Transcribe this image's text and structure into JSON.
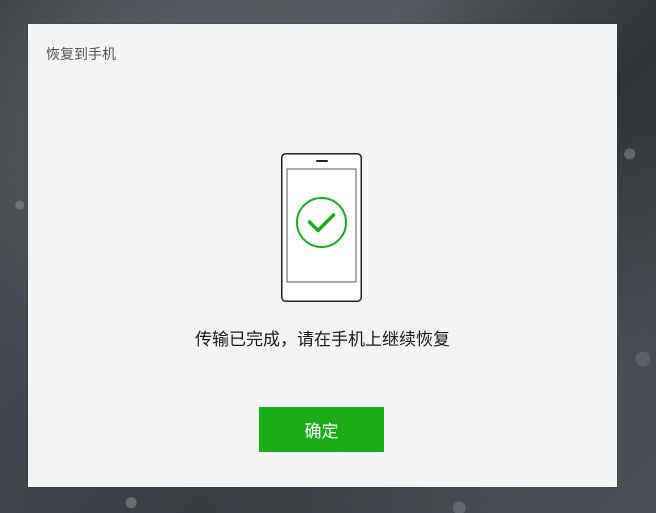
{
  "dialog": {
    "title": "恢复到手机",
    "message": "传输已完成，请在手机上继续恢复",
    "confirm_label": "确定"
  },
  "icons": {
    "phone": "phone-icon",
    "check": "check-circle-icon"
  },
  "colors": {
    "accent": "#1aad19",
    "dialog_bg": "#f4f4f4",
    "text": "#1a1a1a",
    "title_text": "#555555"
  }
}
